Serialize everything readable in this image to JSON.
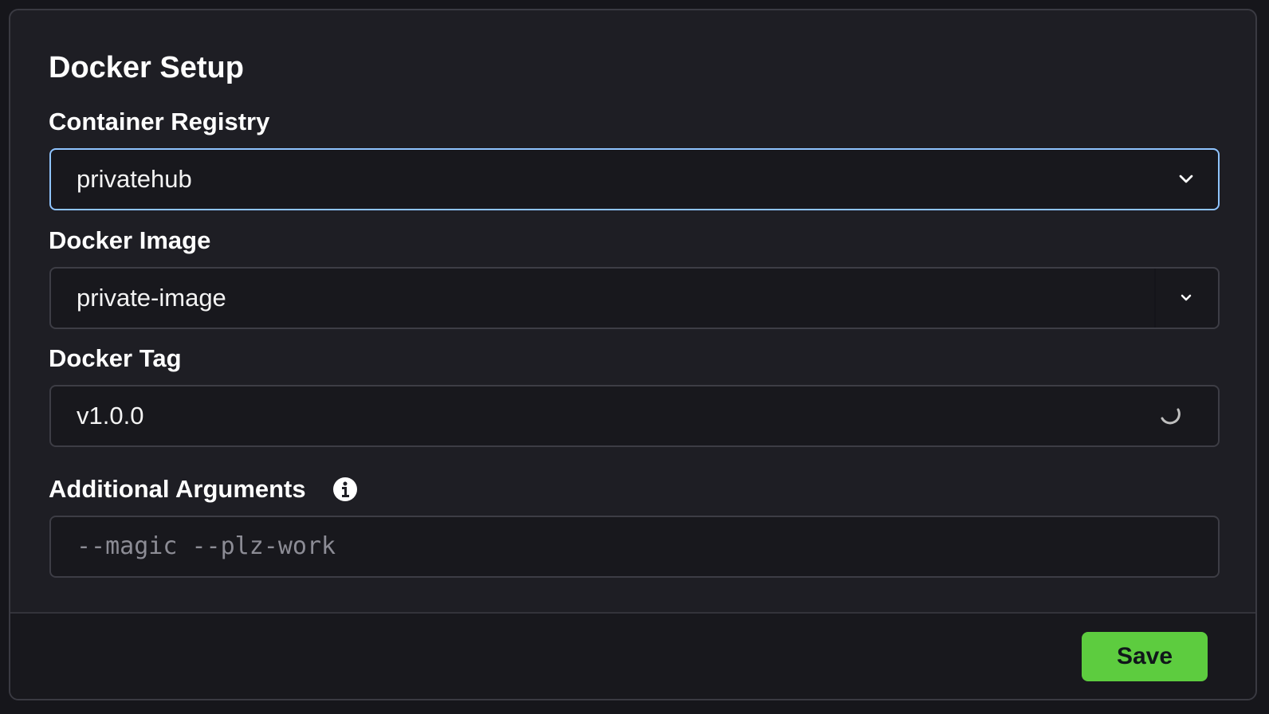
{
  "title": "Docker Setup",
  "registry": {
    "label": "Container Registry",
    "value": "privatehub",
    "icon": "chevron-down-icon"
  },
  "image": {
    "label": "Docker Image",
    "value": "private-image",
    "icon": "chevron-down-icon"
  },
  "tag": {
    "label": "Docker Tag",
    "value": "v1.0.0",
    "icon": "loading-spinner-icon"
  },
  "arguments": {
    "label": "Additional Arguments",
    "placeholder": "--magic --plz-work",
    "icon": "info-icon"
  },
  "footer": {
    "save_label": "Save"
  },
  "colors": {
    "focus_border": "#8fc4ff",
    "save_button": "#5dcc3f"
  }
}
